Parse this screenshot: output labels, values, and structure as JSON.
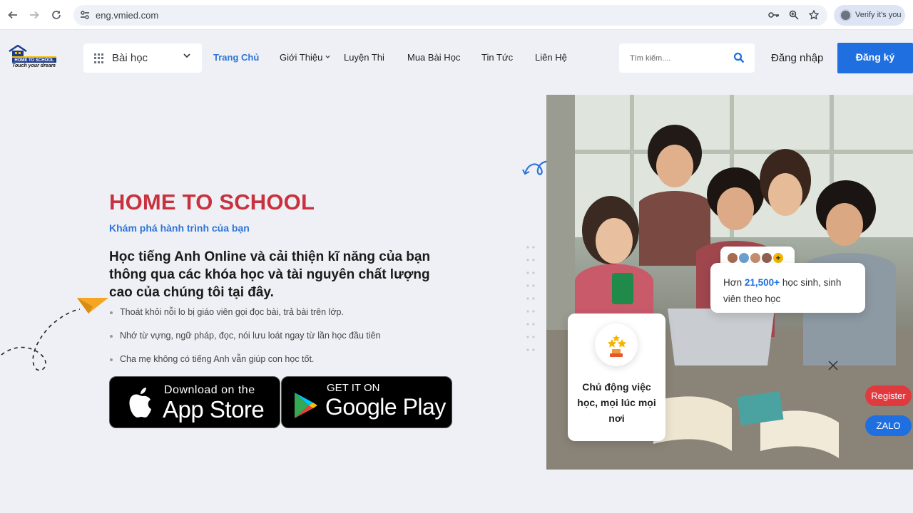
{
  "browser": {
    "url": "eng.vmied.com",
    "verify_label": "Verify it's you",
    "icons": [
      "back-icon",
      "forward-icon",
      "reload-icon",
      "site-settings-icon",
      "key-icon",
      "zoom-icon",
      "star-icon",
      "profile-icon"
    ]
  },
  "header": {
    "logo_text": "HOME TO SCHOOL",
    "logo_tagline": "Touch your dream",
    "category_label": "Bài học",
    "menu": [
      {
        "label": "Trang Chủ"
      },
      {
        "label": "Giới Thiệu"
      },
      {
        "label": "Luyện Thi"
      },
      {
        "label": "Mua Bài Học"
      },
      {
        "label": "Tin Tức"
      },
      {
        "label": "Liên Hệ"
      }
    ],
    "search_placeholder": "Tìm kiếm....",
    "login_label": "Đăng nhập",
    "register_label": "Đăng ký"
  },
  "hero": {
    "title": "HOME TO SCHOOL",
    "subtitle": "Khám phá hành trình của bạn",
    "description": "Học tiếng Anh Online và cải thiện kĩ năng của bạn thông qua các khóa học và tài nguyên chất lượng cao của chúng tôi tại đây.",
    "bullets": [
      "Thoát khỏi nỗi lo bị giáo viên gọi đọc bài, trả bài trên lớp.",
      "Nhớ từ vựng, ngữ pháp, đọc, nói lưu loát ngay từ lần học đầu tiên",
      "Cha mẹ không có tiếng Anh vẫn giúp con học tốt."
    ],
    "appstore": {
      "small": "Download on the",
      "big": "App Store"
    },
    "playstore": {
      "small": "GET IT ON",
      "big": "Google Play"
    }
  },
  "cards": {
    "students_prefix": "Hơn ",
    "students_count": "21,500+",
    "students_suffix": " học sinh, sinh viên theo học",
    "flex_text": "Chủ động việc học, mọi lúc mọi nơi"
  },
  "floating": {
    "register": "Register",
    "zalo": "ZALO"
  },
  "colors": {
    "accent_blue": "#1f6fe0",
    "title_red": "#c8323e",
    "register_red": "#e0393e"
  }
}
